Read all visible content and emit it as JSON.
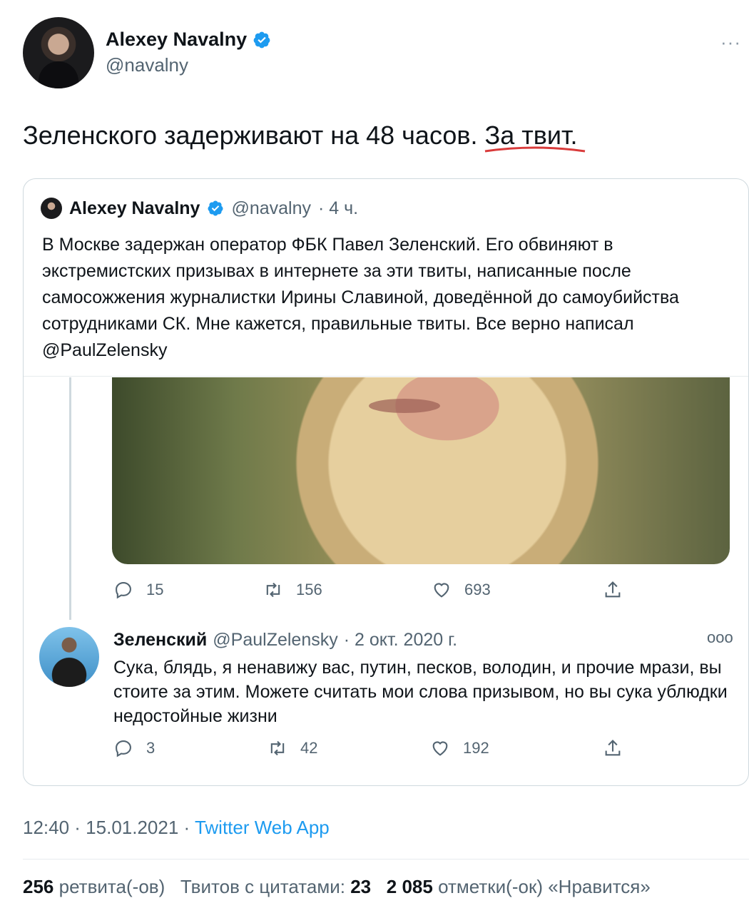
{
  "tweet": {
    "author_name": "Alexey Navalny",
    "author_handle": "@navalny",
    "more_label": "···",
    "text_main": "Зеленского задерживают на 48 часов. ",
    "text_underlined": "За твит.",
    "timestamp": "12:40 · 15.01.2021 · ",
    "source": "Twitter Web App",
    "stats": {
      "retweets_count": "256",
      "retweets_label": "ретвита(-ов)",
      "quotes_label": "Твитов с цитатами:",
      "quotes_count": "23",
      "likes_count": "2 085",
      "likes_label": "отметки(-ок) «Нравится»"
    }
  },
  "quoted": {
    "author_name": "Alexey Navalny",
    "author_handle": "@navalny",
    "time": "· 4 ч.",
    "text": "В Москве задержан оператор ФБК Павел Зеленский. Его обвиняют в экстремистских призывах в интернете за эти твиты, написанные после самосожжения журналистки Ирины Славиной, доведённой до самоубийства сотрудниками СК. Мне кажется, правильные твиты. Все верно написал @PaulZelensky",
    "actions": {
      "replies": "15",
      "retweets": "156",
      "likes": "693"
    }
  },
  "reply": {
    "author_name": "Зеленский",
    "author_handle": "@PaulZelensky",
    "date": "· 2 окт. 2020 г.",
    "more_label": "ooo",
    "text": "Сука, блядь, я ненавижу вас, путин, песков, володин, и прочие мрази, вы стоите за этим. Можете считать мои слова призывом, но вы сука ублюдки недостойные жизни",
    "actions": {
      "replies": "3",
      "retweets": "42",
      "likes": "192"
    }
  },
  "colors": {
    "accent": "#1d9bf0",
    "secondary_text": "#536471",
    "underline": "#d93b3b"
  }
}
